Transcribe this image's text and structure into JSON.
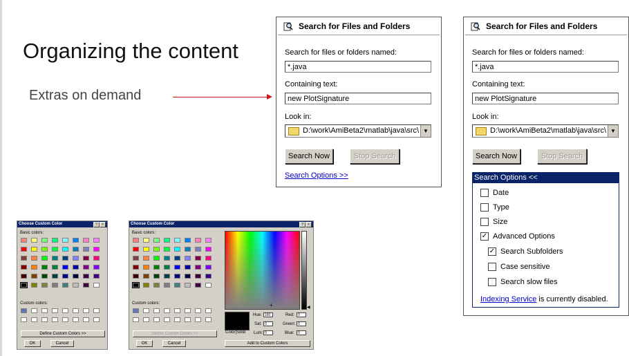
{
  "slide": {
    "title": "Organizing the content",
    "subtitle": "Extras on demand"
  },
  "search_panel_left": {
    "header": "Search for Files and Folders",
    "named_label": "Search for files or folders named:",
    "named_value": "*.java",
    "containing_label": "Containing text:",
    "containing_value": "new PlotSignature",
    "lookin_label": "Look in:",
    "lookin_value": "D:\\work\\AmiBeta2\\matlab\\java\\src\\",
    "search_now": "Search Now",
    "stop_search": "Stop Search",
    "options_link": "Search Options  >>"
  },
  "search_panel_right": {
    "header": "Search for Files and Folders",
    "named_label": "Search for files or folders named:",
    "named_value": "*.java",
    "containing_label": "Containing text:",
    "containing_value": "new PlotSignature",
    "lookin_label": "Look in:",
    "lookin_value": "D:\\work\\AmiBeta2\\matlab\\java\\src\\",
    "search_now": "Search Now",
    "stop_search": "Stop Search",
    "options_header": "Search Options  <<",
    "options": [
      {
        "label": "Date",
        "checked": false
      },
      {
        "label": "Type",
        "checked": false
      },
      {
        "label": "Size",
        "checked": false
      },
      {
        "label": "Advanced Options",
        "checked": true
      },
      {
        "label": "Search Subfolders",
        "checked": true
      },
      {
        "label": "Case sensitive",
        "checked": false
      },
      {
        "label": "Search slow files",
        "checked": false
      }
    ],
    "indexing_link": "Indexing Service",
    "indexing_text": " is currently disabled."
  },
  "color_dialog_small": {
    "title": "Choose Custom Color",
    "help": "?",
    "close": "×",
    "basic_label": "Basic colors:",
    "custom_label": "Custom colors:",
    "define_button": "Define Custom Colors >>",
    "ok": "OK",
    "cancel": "Cancel"
  },
  "color_dialog_large": {
    "title": "Choose Custom Color",
    "help": "?",
    "close": "×",
    "basic_label": "Basic colors:",
    "custom_label": "Custom colors:",
    "define_button": "Define Custom Colors >>",
    "ok": "OK",
    "cancel": "Cancel",
    "hue_label": "Hue:",
    "hue": "160",
    "sat_label": "Sat:",
    "sat": "0",
    "lum_label": "Lum:",
    "lum": "0",
    "red_label": "Red:",
    "red": "0",
    "green_label": "Green:",
    "green": "0",
    "blue_label": "Blue:",
    "blue": "0",
    "color_solid": "Color|Solid",
    "add_button": "Add to Custom Colors"
  },
  "basic_colors": [
    "#ff8080",
    "#ffff80",
    "#80ff80",
    "#00ff80",
    "#80ffff",
    "#0080ff",
    "#ff80c0",
    "#ff80ff",
    "#ff0000",
    "#ffff00",
    "#80ff00",
    "#00ff40",
    "#00ffff",
    "#0080c0",
    "#8080c0",
    "#ff00ff",
    "#804040",
    "#ff8040",
    "#00ff00",
    "#008080",
    "#004080",
    "#8080ff",
    "#800040",
    "#ff0080",
    "#800000",
    "#ff8000",
    "#008000",
    "#008040",
    "#0000ff",
    "#0000a0",
    "#800080",
    "#8000ff",
    "#400000",
    "#804000",
    "#004000",
    "#004040",
    "#000080",
    "#000040",
    "#400040",
    "#400080",
    "#000000",
    "#808000",
    "#808040",
    "#808080",
    "#408080",
    "#c0c0c0",
    "#400040",
    "#ffffff"
  ],
  "custom_colors": [
    "#6078b8",
    "#ffffff",
    "#ffffff",
    "#ffffff",
    "#ffffff",
    "#ffffff",
    "#ffffff",
    "#ffffff",
    "#ffffff",
    "#ffffff",
    "#ffffff",
    "#ffffff",
    "#ffffff",
    "#ffffff",
    "#ffffff",
    "#ffffff"
  ],
  "icons": {
    "search_panel": "search-magnifier-icon",
    "folder": "folder-icon",
    "dropdown": "dropdown-arrow-icon"
  }
}
